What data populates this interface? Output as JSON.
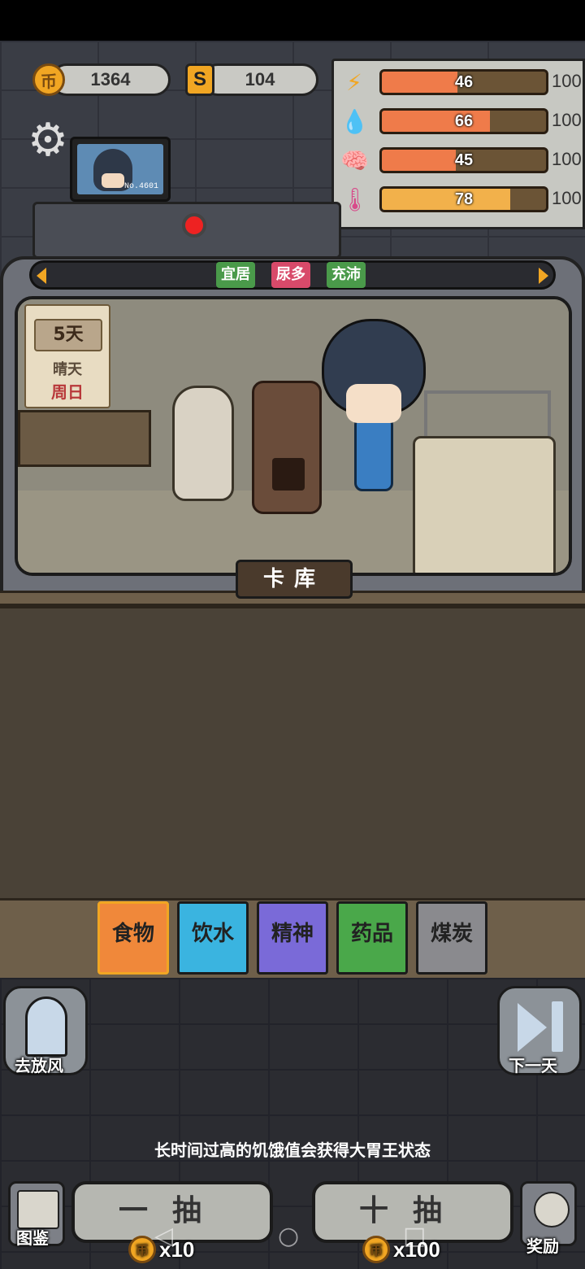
{
  "currency": {
    "coins": "1364",
    "s_icon": "S",
    "s_value": "104",
    "coin_glyph": "币"
  },
  "stats": [
    {
      "icon": "lightning-icon",
      "glyph": "⚡",
      "value": "46",
      "max": "100",
      "fraction": 0.46,
      "color": "#ef7b4a"
    },
    {
      "icon": "water-drop-icon",
      "glyph": "💧",
      "value": "66",
      "max": "100",
      "fraction": 0.66,
      "color": "#ef7b4a"
    },
    {
      "icon": "brain-icon",
      "glyph": "🧠",
      "value": "45",
      "max": "100",
      "fraction": 0.45,
      "color": "#ef7b4a"
    },
    {
      "icon": "thermometer-icon",
      "glyph": "🌡",
      "value": "78",
      "max": "100",
      "fraction": 0.78,
      "color": "#f2b14b"
    }
  ],
  "monitor": {
    "number": "No.4601"
  },
  "tags": [
    {
      "label": "宜居",
      "color": "#4a9a4a"
    },
    {
      "label": "尿多",
      "color": "#d84a6a"
    },
    {
      "label": "充沛",
      "color": "#4a9a4a"
    }
  ],
  "calendar": {
    "day": "5天",
    "weather": "晴天",
    "weekday": "周日"
  },
  "card_library": {
    "label": "卡库"
  },
  "categories": [
    {
      "label": "食物",
      "color": "#f0883a"
    },
    {
      "label": "饮水",
      "color": "#3ab4e0"
    },
    {
      "label": "精神",
      "color": "#7a6ad8"
    },
    {
      "label": "药品",
      "color": "#4aa84a"
    },
    {
      "label": "煤炭",
      "color": "#8a8a8e"
    }
  ],
  "actions": {
    "go_out": "去放风",
    "next_day": "下一天"
  },
  "tip": "长时间过高的饥饿值会获得大胃王状态",
  "draw": {
    "single": {
      "label": "一抽",
      "cost": "x10"
    },
    "ten": {
      "label": "十抽",
      "cost": "x100"
    }
  },
  "bottom": {
    "catalog": "图鉴",
    "reward": "奖励"
  }
}
